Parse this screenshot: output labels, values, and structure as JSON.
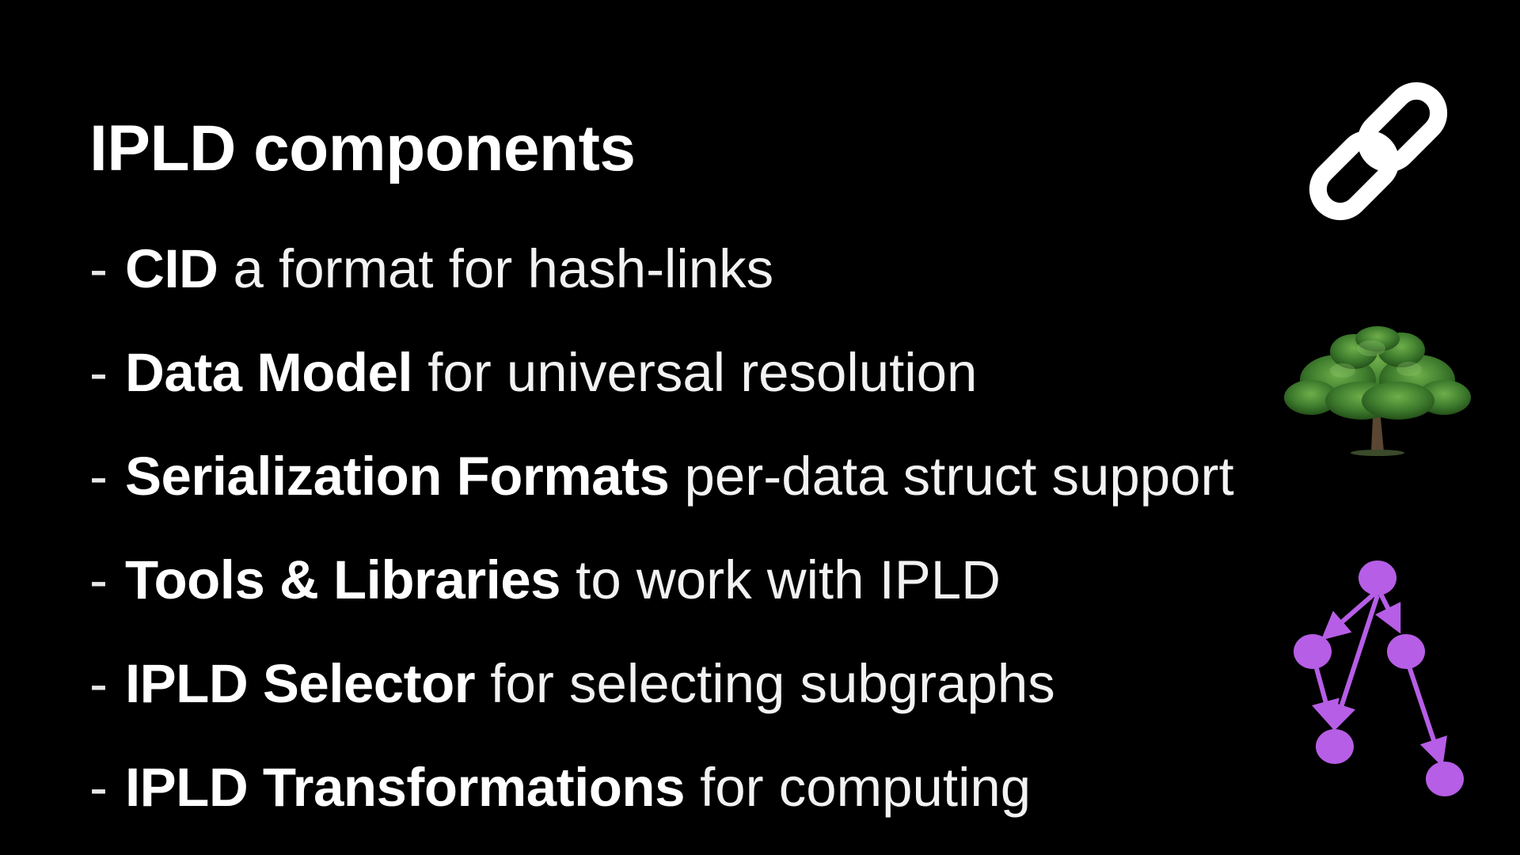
{
  "slide": {
    "title": "IPLD components",
    "bullets": [
      {
        "dash": "-",
        "term": "CID",
        "desc": "a format for hash-links"
      },
      {
        "dash": "-",
        "term": "Data Model",
        "desc": "for universal resolution"
      },
      {
        "dash": "-",
        "term": "Serialization Formats",
        "desc": "per-data struct support"
      },
      {
        "dash": "-",
        "term": "Tools & Libraries",
        "desc": "to work with IPLD"
      },
      {
        "dash": "-",
        "term": "IPLD Selector",
        "desc": "for selecting subgraphs"
      },
      {
        "dash": "-",
        "term": "IPLD Transformations",
        "desc": "for computing"
      }
    ]
  },
  "icons": {
    "link": "chain-link-icon",
    "tree": "tree-icon",
    "dag": "dag-graph-icon"
  },
  "colors": {
    "background": "#000000",
    "text": "#ffffff",
    "graph_purple": "#b65ee6",
    "tree_green": "#3f7d2e"
  }
}
